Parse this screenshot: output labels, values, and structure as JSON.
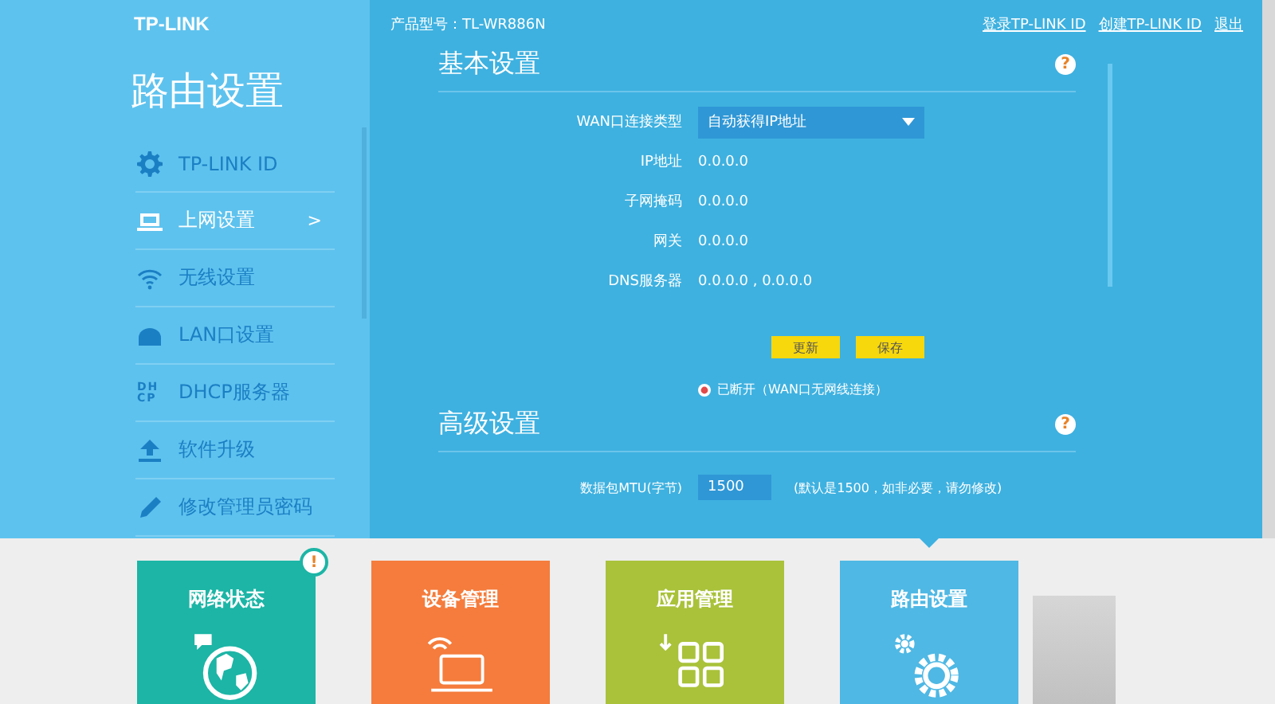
{
  "header": {
    "logo": "TP-LINK",
    "product_model": "产品型号：TL-WR886N",
    "links": [
      "登录TP-LINK ID",
      "创建TP-LINK ID",
      "退出"
    ]
  },
  "sidebar": {
    "title": "路由设置",
    "items": [
      {
        "label": "TP-LINK ID",
        "kind": "gear",
        "selected": false
      },
      {
        "label": "上网设置",
        "kind": "laptop",
        "selected": true,
        "arrow": ">"
      },
      {
        "label": "无线设置",
        "kind": "wifi",
        "selected": false
      },
      {
        "label": "LAN口设置",
        "kind": "lan",
        "selected": false
      },
      {
        "label": "DHCP服务器",
        "kind": "dhcp",
        "selected": false,
        "icon_text": "DH CP"
      },
      {
        "label": "软件升级",
        "kind": "upgrade",
        "selected": false
      },
      {
        "label": "修改管理员密码",
        "kind": "pencil",
        "selected": false
      }
    ]
  },
  "basic": {
    "title": "基本设置",
    "help": "?",
    "wan_type": {
      "label": "WAN口连接类型",
      "value": "自动获得IP地址"
    },
    "fields": [
      {
        "label": "IP地址",
        "value": "0.0.0.0"
      },
      {
        "label": "子网掩码",
        "value": "0.0.0.0"
      },
      {
        "label": "网关",
        "value": "0.0.0.0"
      },
      {
        "label": "DNS服务器",
        "value": "0.0.0.0 , 0.0.0.0"
      }
    ],
    "buttons": [
      "更新",
      "保存"
    ],
    "status": "已断开（WAN口无网线连接）"
  },
  "advanced": {
    "title": "高级设置",
    "help": "?",
    "mtu": {
      "label": "数据包MTU(字节)",
      "value": "1500",
      "hint": "(默认是1500，如非必要，请勿修改)"
    }
  },
  "tiles": [
    {
      "label": "网络状态",
      "kind": "globe",
      "color": "#1cb5a6",
      "badge": "!",
      "selected": false
    },
    {
      "label": "设备管理",
      "kind": "laptop",
      "color": "#f57c3c",
      "selected": false
    },
    {
      "label": "应用管理",
      "kind": "apps",
      "color": "#a9c23a",
      "selected": false
    },
    {
      "label": "路由设置",
      "kind": "gears",
      "color": "#4fb8e4",
      "selected": true
    }
  ]
}
